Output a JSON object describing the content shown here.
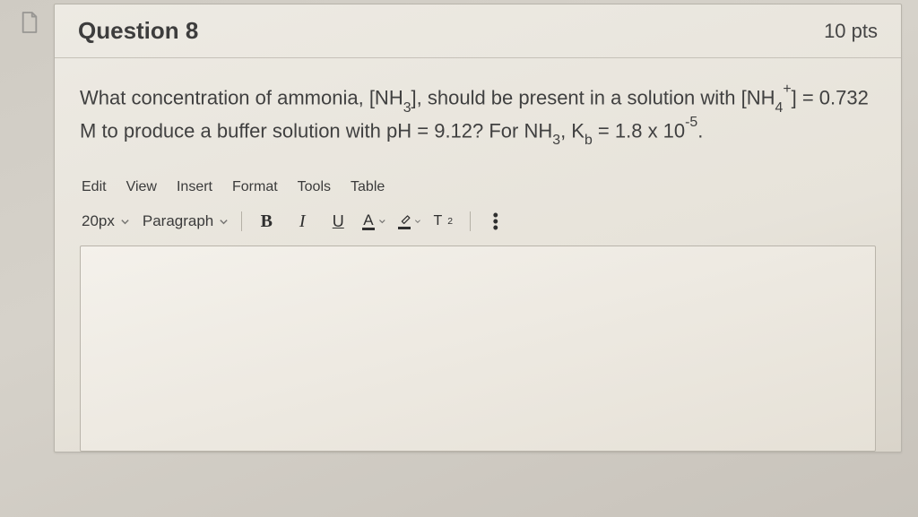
{
  "question": {
    "number": 8,
    "title": "Question 8",
    "points_label": "10 pts",
    "stem_parts": {
      "p1": "What concentration of ammonia, [NH",
      "p2": "], should be present in a solution with [NH",
      "p3": "] = 0.732 M to produce a buffer solution with pH = 9.12? For NH",
      "p4": ", K",
      "p5": " = 1.8 x 10",
      "p6": "."
    }
  },
  "editor": {
    "menu": {
      "edit": "Edit",
      "view": "View",
      "insert": "Insert",
      "format": "Format",
      "tools": "Tools",
      "table": "Table"
    },
    "toolbar": {
      "font_size": "20px",
      "block_format": "Paragraph",
      "bold": "B",
      "italic": "I",
      "underline": "U",
      "text_color_letter": "A",
      "superscript_label": "T",
      "superscript_exp": "2"
    },
    "content": ""
  }
}
